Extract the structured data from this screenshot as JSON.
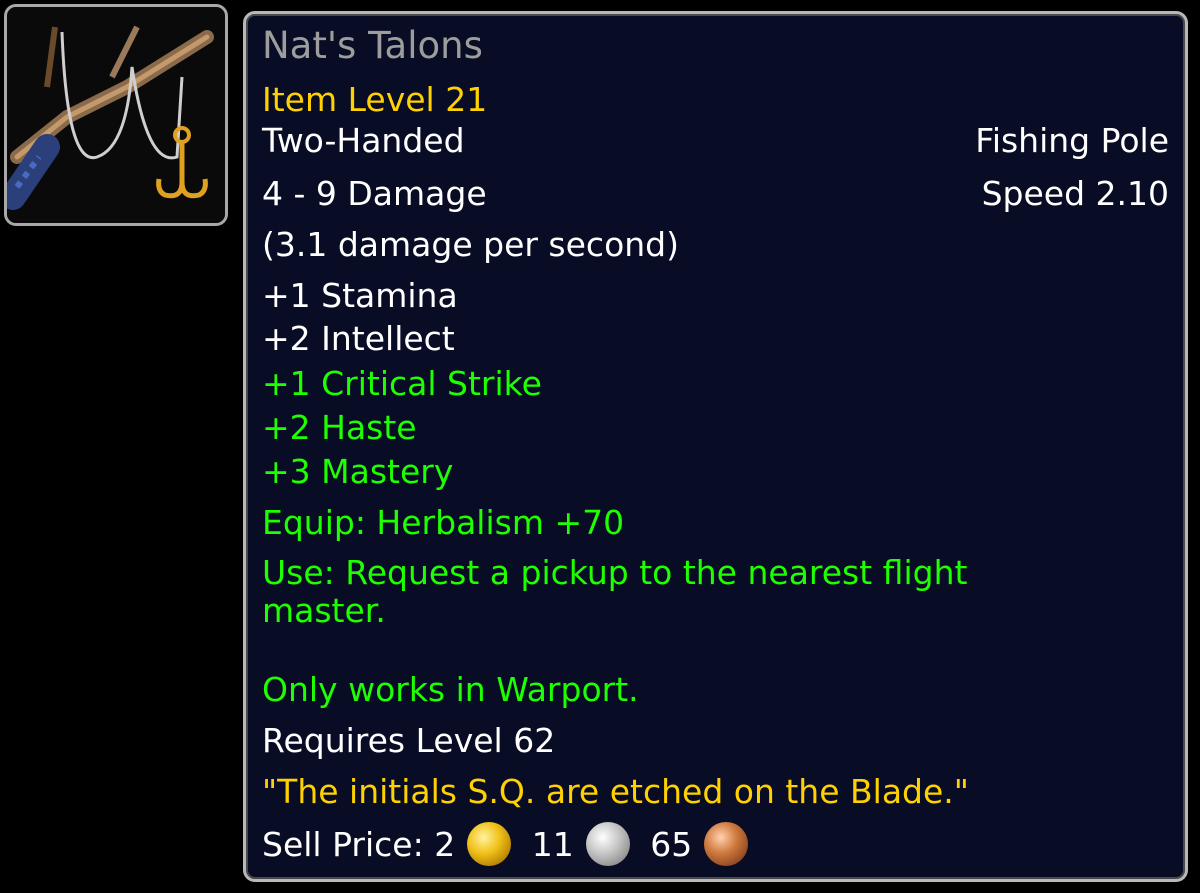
{
  "item": {
    "icon": "fishing-pole-icon",
    "name": "Nat's Talons",
    "item_level": "Item Level 21",
    "slot": "Two-Handed",
    "type": "Fishing Pole",
    "damage": "4 - 9 Damage",
    "speed": "Speed 2.10",
    "dps": "(3.1 damage per second)",
    "stats": [
      "+1 Stamina",
      "+2 Intellect"
    ],
    "secondary_stats": [
      "+1 Critical Strike",
      "+2 Haste",
      "+3 Mastery"
    ],
    "equip": "Equip: Herbalism +70",
    "use": "Use: Request a pickup to the nearest flight master.",
    "note": "Only works in Warport.",
    "requires": "Requires Level 62",
    "flavor": "\"The initials S.Q. are etched on the Blade.\"",
    "sell_price": {
      "label": "Sell Price:",
      "gold": "2",
      "silver": "11",
      "copper": "65"
    }
  },
  "colors": {
    "name": "#9d9d9d",
    "item_level": "#ffd100",
    "bonus": "#1eff00",
    "flavor": "#ffd100",
    "background": "#080c24",
    "border": "#b8b8b8"
  }
}
